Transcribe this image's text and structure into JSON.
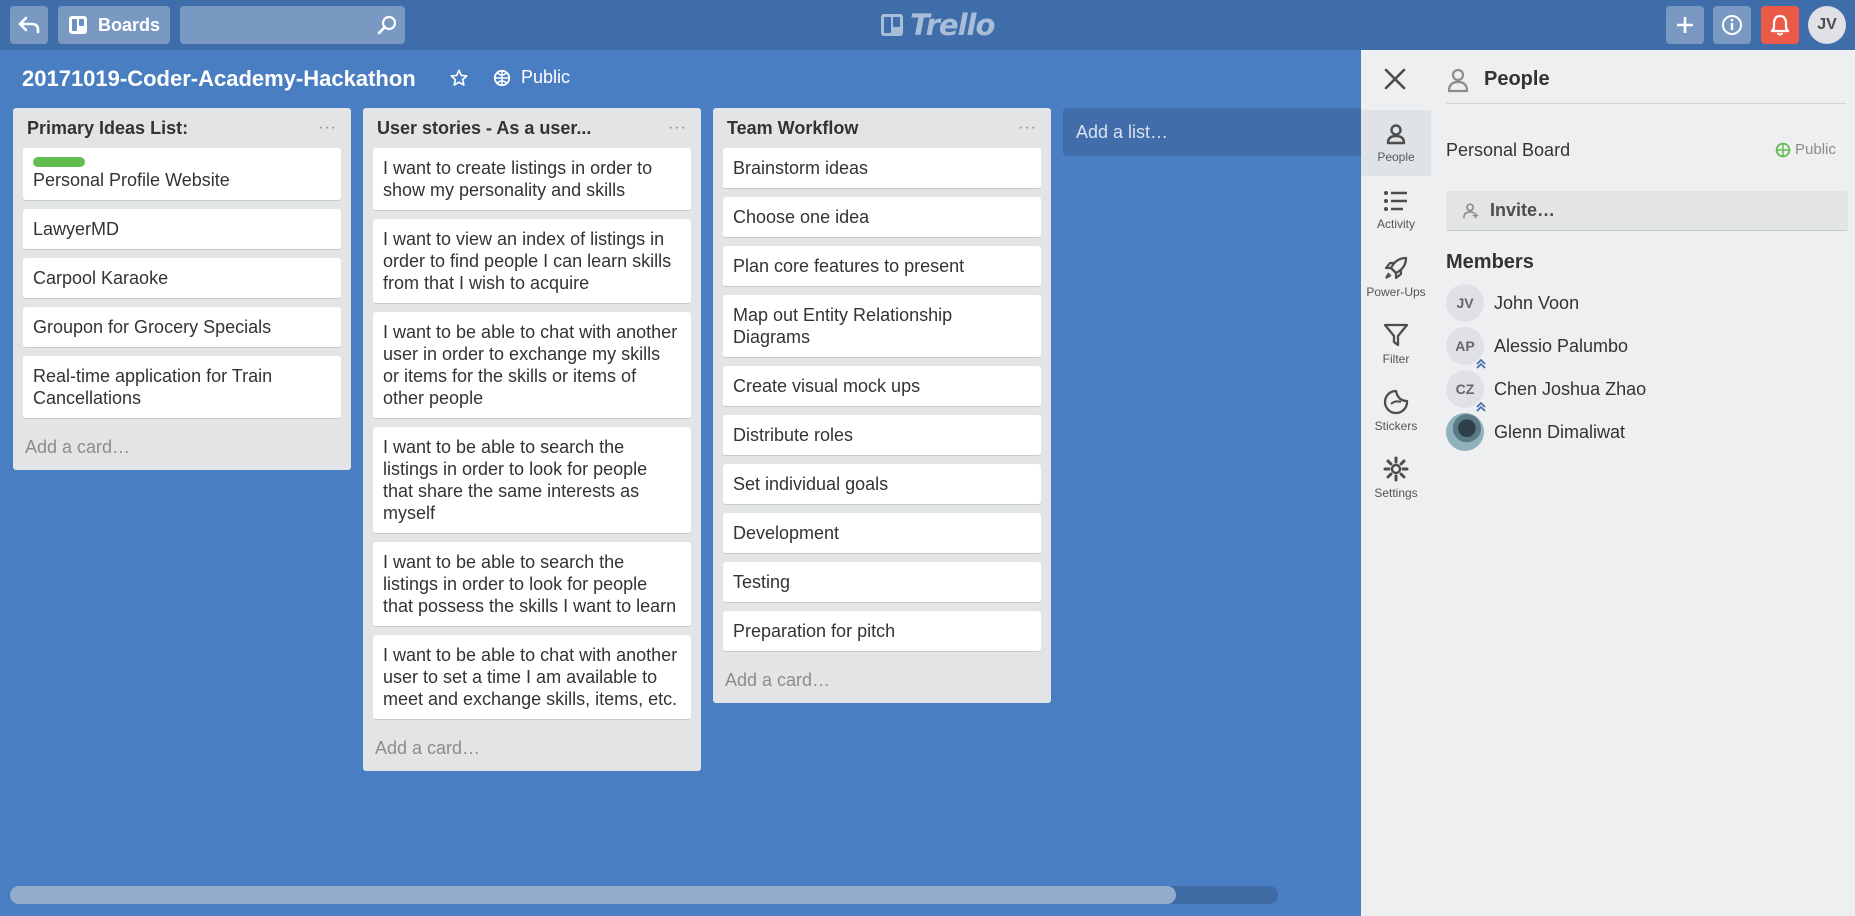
{
  "header": {
    "boards_label": "Boards",
    "search_value": "",
    "logo_text": "Trello",
    "user_initials": "JV",
    "accent": "#3f6da9",
    "notify_color": "#eb5a46"
  },
  "board": {
    "title": "20171019-Coder-Academy-Hackathon",
    "visibility": "Public",
    "background": "#4a7ec2"
  },
  "lists": [
    {
      "title": "Primary Ideas List:",
      "add_card": "Add a card…",
      "cards": [
        {
          "text": "Personal Profile Website",
          "label_color": "#61bd4f"
        },
        {
          "text": "LawyerMD"
        },
        {
          "text": "Carpool Karaoke"
        },
        {
          "text": "Groupon for Grocery Specials"
        },
        {
          "text": "Real-time application for Train Cancellations"
        }
      ]
    },
    {
      "title": "User stories - As a user...",
      "add_card": "Add a card…",
      "cards": [
        {
          "text": "I want to create listings in order to show my personality and skills"
        },
        {
          "text": "I want to view an index of listings in order to find people I can learn skills from that I wish to acquire"
        },
        {
          "text": "I want to be able to chat with another user in order to exchange my skills or items for the skills or items of other people"
        },
        {
          "text": "I want to be able to search the listings in order to look for people that share the same interests as myself"
        },
        {
          "text": "I want to be able to search the listings in order to look for people that possess the skills I want to learn"
        },
        {
          "text": "I want to be able to chat with another user to set a time I am available to meet and exchange skills, items, etc."
        }
      ]
    },
    {
      "title": "Team Workflow",
      "add_card": "Add a card…",
      "cards": [
        {
          "text": "Brainstorm ideas"
        },
        {
          "text": "Choose one idea"
        },
        {
          "text": "Plan core features to present"
        },
        {
          "text": "Map out Entity Relationship Diagrams"
        },
        {
          "text": "Create visual mock ups"
        },
        {
          "text": "Distribute roles"
        },
        {
          "text": "Set individual goals"
        },
        {
          "text": "Development"
        },
        {
          "text": "Testing"
        },
        {
          "text": "Preparation for pitch"
        }
      ]
    }
  ],
  "add_list": "Add a list…",
  "sidebar": {
    "rail": [
      {
        "label": "People",
        "icon": "person-icon"
      },
      {
        "label": "Activity",
        "icon": "activity-list-icon"
      },
      {
        "label": "Power-Ups",
        "icon": "rocket-icon"
      },
      {
        "label": "Filter",
        "icon": "filter-icon"
      },
      {
        "label": "Stickers",
        "icon": "sticker-icon"
      },
      {
        "label": "Settings",
        "icon": "gear-icon"
      }
    ],
    "panel_title": "People",
    "board_kind": "Personal Board",
    "board_visibility": "Public",
    "invite_label": "Invite…",
    "members_title": "Members",
    "members": [
      {
        "initials": "JV",
        "name": "John Voon",
        "admin": false
      },
      {
        "initials": "AP",
        "name": "Alessio Palumbo",
        "admin": true
      },
      {
        "initials": "CZ",
        "name": "Chen Joshua Zhao",
        "admin": true
      },
      {
        "initials": "",
        "name": "Glenn Dimaliwat",
        "admin": false
      }
    ]
  }
}
